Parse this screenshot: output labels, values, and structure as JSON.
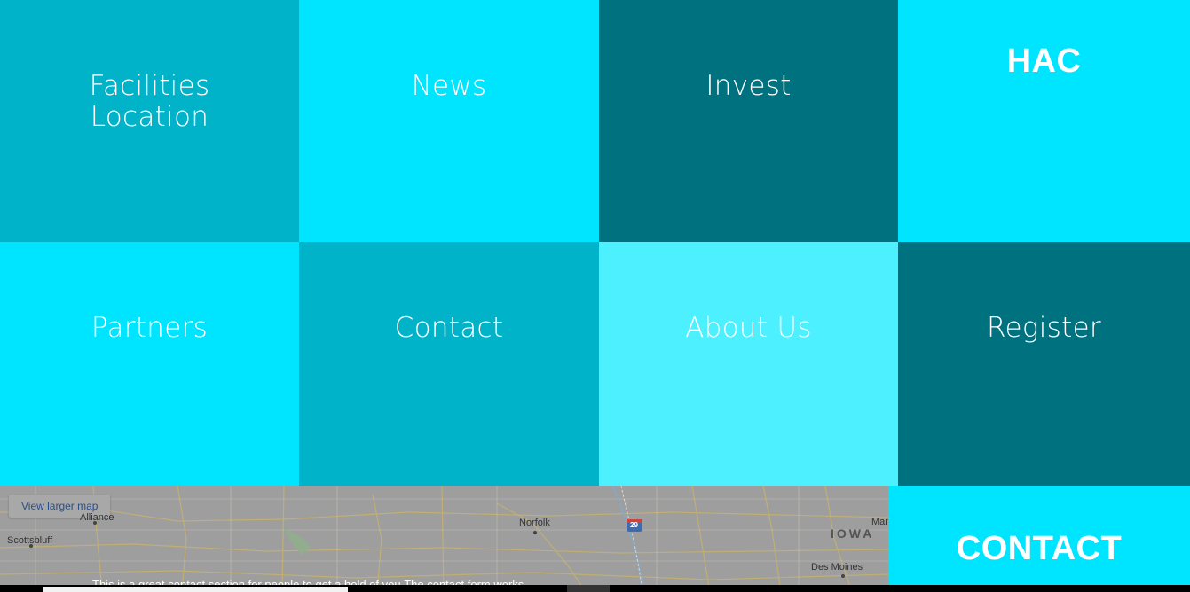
{
  "nav": {
    "tiles": [
      {
        "label": "Facilities\nLocation",
        "color": "#00b3c9"
      },
      {
        "label": "News",
        "color": "#00e5ff"
      },
      {
        "label": "Invest",
        "color": "#00717e"
      },
      {
        "label": "HAC",
        "color": "#00e5ff"
      },
      {
        "label": "Partners",
        "color": "#00e5ff"
      },
      {
        "label": "Contact",
        "color": "#00b3c9"
      },
      {
        "label": "About Us",
        "color": "#4df0ff"
      },
      {
        "label": "Register",
        "color": "#00717e"
      }
    ]
  },
  "map": {
    "view_larger": "View larger map",
    "cities": {
      "alliance": "Alliance",
      "scottsbluff": "Scottsbluff",
      "norfolk": "Norfolk",
      "des_moines": "Des Moines",
      "mars": "Mars"
    },
    "state": "IOWA",
    "highway": "29"
  },
  "contact": {
    "title": "CONTACT",
    "note": "This is a great contact section for people to get a hold of you.The contact form works"
  }
}
